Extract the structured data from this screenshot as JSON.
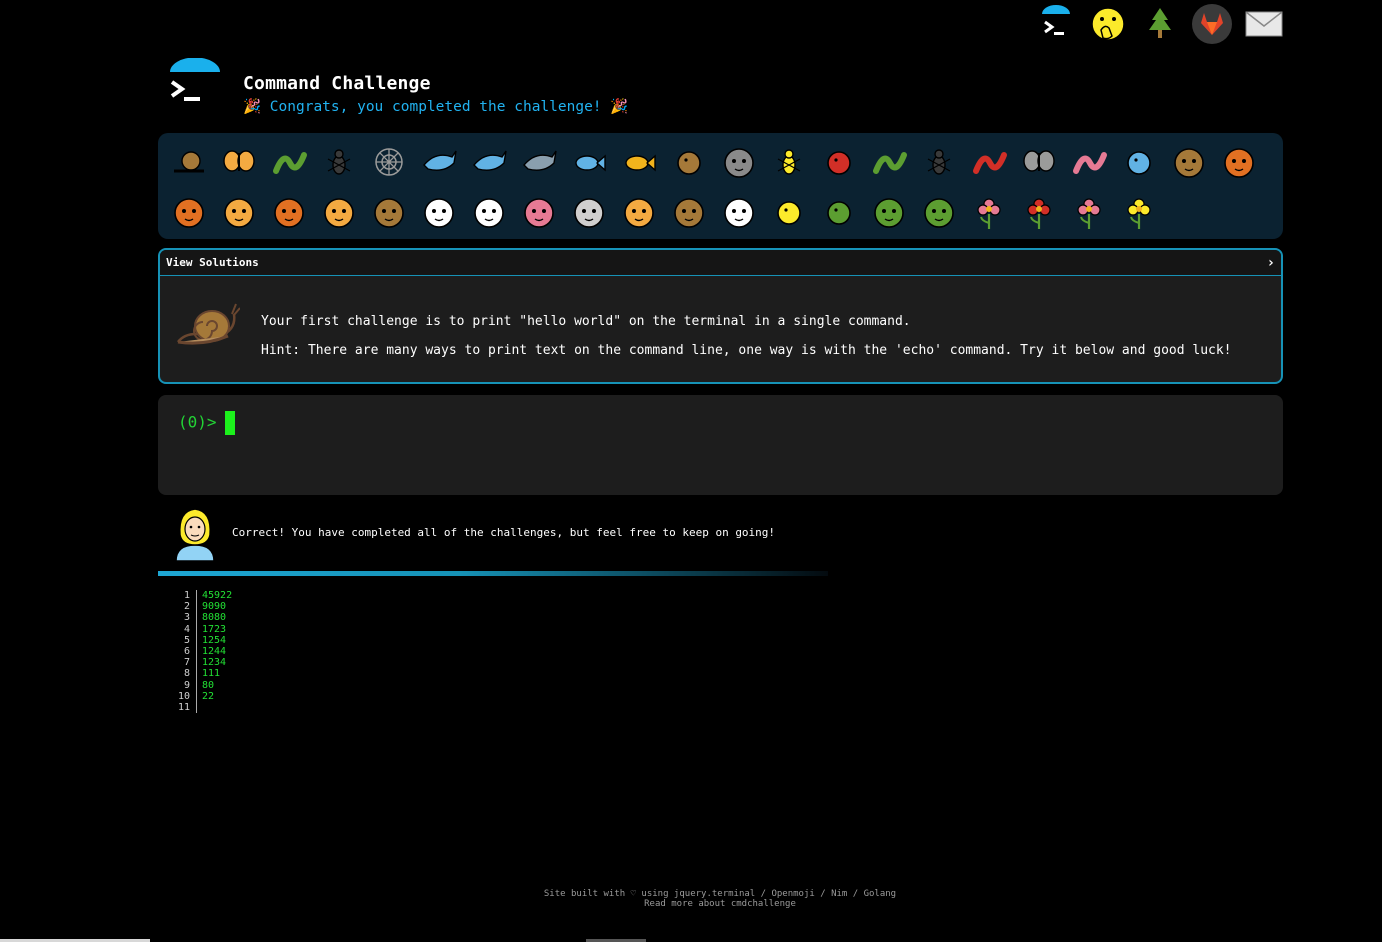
{
  "header": {
    "title": "Command Challenge",
    "subtitle": "Congrats, you completed the challenge!",
    "party_left": "🎉",
    "party_right": "🎉",
    "top_icons": [
      "terminal-logo-icon",
      "hand-over-mouth-icon",
      "tree-icon",
      "gitlab-icon",
      "mail-icon"
    ]
  },
  "emoji_bar": {
    "row1": [
      "snail",
      "butterfly",
      "caterpillar",
      "ant",
      "spider-web",
      "whale",
      "dolphin",
      "shark",
      "fish",
      "tropical-fish",
      "blowfish",
      "wolf",
      "bee",
      "ladybug",
      "cricket",
      "spider",
      "scorpion",
      "fly",
      "worm",
      "microbe",
      "monkey",
      "dog"
    ],
    "row2": [
      "fox",
      "cat",
      "lion",
      "tiger",
      "horse",
      "unicorn",
      "cow",
      "pig",
      "mouse",
      "hamster",
      "bear",
      "panda",
      "hatching-chick",
      "peacock",
      "frog",
      "dragon",
      "cherry-blossom",
      "rose",
      "hibiscus",
      "sunflower"
    ]
  },
  "solution": {
    "toggle_label": "View Solutions",
    "chevron": "›",
    "challenge": "Your first challenge is to print \"hello world\" on the terminal in a single command.",
    "hint": "Hint: There are many ways to print text on the command line, one way is with the 'echo' command. Try it below and good luck!"
  },
  "terminal": {
    "prompt": "(0)>"
  },
  "result": {
    "message": "Correct! You have completed all of the challenges, but feel free to keep on going!"
  },
  "output": {
    "lines": [
      {
        "n": "1",
        "v": "45922"
      },
      {
        "n": "2",
        "v": "9090"
      },
      {
        "n": "3",
        "v": "8080"
      },
      {
        "n": "4",
        "v": "1723"
      },
      {
        "n": "5",
        "v": "1254"
      },
      {
        "n": "6",
        "v": "1244"
      },
      {
        "n": "7",
        "v": "1234"
      },
      {
        "n": "8",
        "v": "111"
      },
      {
        "n": "9",
        "v": "80"
      },
      {
        "n": "10",
        "v": "22"
      },
      {
        "n": "11",
        "v": ""
      }
    ]
  },
  "footer": {
    "line1": "Site built with ♡ using jquery.terminal / Openmoji / Nim / Golang",
    "line2": "Read more about cmdchallenge"
  },
  "colors": {
    "accent": "#21b2f0",
    "border": "#1692b6",
    "prompt": "#22d435",
    "panel": "#1d1d1d",
    "emoji_bar": "#0b2231"
  }
}
